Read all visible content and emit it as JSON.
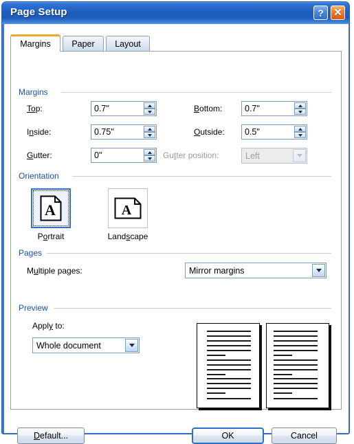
{
  "window": {
    "title": "Page Setup",
    "help_button": "?",
    "close_button": "✕",
    "accent_title_blue": "#1f5ec0",
    "accent_tab_orange": "#f0a72a",
    "group_label_blue": "#1f4fa8"
  },
  "tabs": [
    {
      "label": "Margins",
      "active": true
    },
    {
      "label": "Paper",
      "active": false
    },
    {
      "label": "Layout",
      "active": false
    }
  ],
  "groups": {
    "margins": "Margins",
    "orientation": "Orientation",
    "pages": "Pages",
    "preview": "Preview"
  },
  "margins": {
    "top": {
      "label_pre": "T",
      "label_key": "o",
      "label_post": "p:",
      "value": "0.7\""
    },
    "bottom": {
      "label_pre": "",
      "label_key": "B",
      "label_post": "ottom:",
      "value": "0.7\""
    },
    "inside": {
      "label_pre": "I",
      "label_key": "n",
      "label_post": "side:",
      "value": "0.75\""
    },
    "outside": {
      "label_pre": "",
      "label_key": "O",
      "label_post": "utside:",
      "value": "0.5\""
    },
    "gutter": {
      "label_pre": "",
      "label_key": "G",
      "label_post": "utter:",
      "value": "0\""
    },
    "gutter_position": {
      "label_pre": "Gu",
      "label_key": "t",
      "label_post": "ter position:",
      "value": "Left",
      "disabled": true
    }
  },
  "orientation": {
    "portrait": {
      "caption_pre": "P",
      "caption_key": "o",
      "caption_post": "rtrait",
      "selected": true
    },
    "landscape": {
      "caption_pre": "Land",
      "caption_key": "s",
      "caption_post": "cape",
      "selected": false
    }
  },
  "pages": {
    "multiple_pages": {
      "label_pre": "M",
      "label_key": "u",
      "label_post": "ltiple pages:",
      "value": "Mirror margins"
    }
  },
  "preview": {
    "apply_to": {
      "label_pre": "Appl",
      "label_key": "y",
      "label_post": " to:",
      "value": "Whole document"
    },
    "pages_shown": 2,
    "page_style": "mirror-margins-facing-pages"
  },
  "footer": {
    "default_button": {
      "label_pre": "",
      "label_key": "D",
      "label_post": "efault..."
    },
    "ok_button": "OK",
    "cancel_button": "Cancel"
  }
}
